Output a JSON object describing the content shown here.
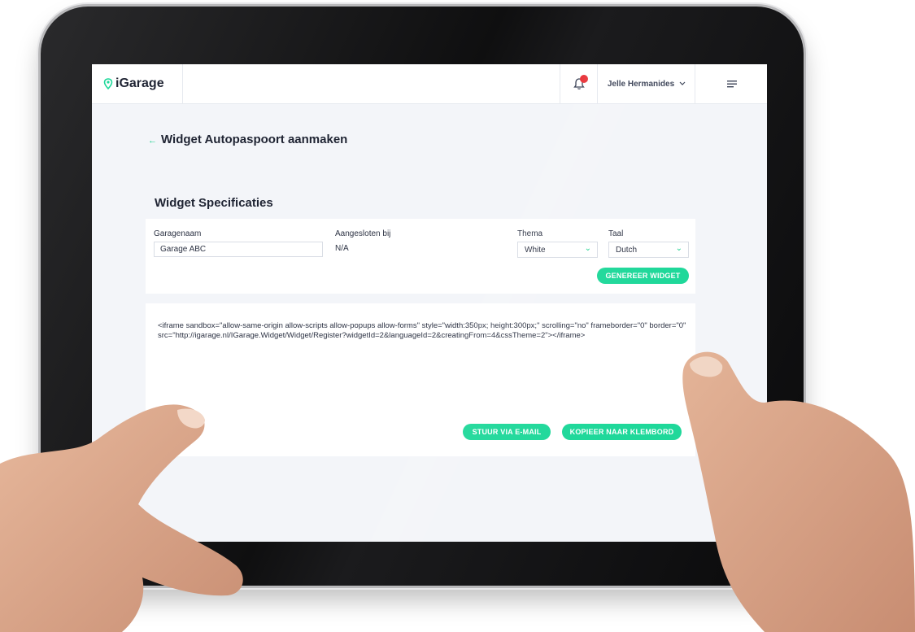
{
  "app": {
    "logo_text": "iGarage",
    "accent_color": "#1fd89a"
  },
  "header": {
    "user_name": "Jelle Hermanides",
    "notification_icon": "bell-icon",
    "menu_icon": "hamburger-icon"
  },
  "page": {
    "title": "Widget Autopaspoort aanmaken",
    "back_icon": "back-arrow-icon"
  },
  "specs": {
    "section_title": "Widget Specificaties",
    "garage_label": "Garagenaam",
    "garage_value": "Garage ABC",
    "connected_label": "Aangesloten bij",
    "connected_value": "N/A",
    "theme_label": "Thema",
    "theme_value": "White",
    "language_label": "Taal",
    "language_value": "Dutch",
    "generate_button": "GENEREER WIDGET"
  },
  "embed": {
    "code": "<iframe sandbox=\"allow-same-origin allow-scripts allow-popups allow-forms\" style=\"width:350px; height:300px;\" scrolling=\"no\" frameborder=\"0\" border=\"0\" src=\"http://igarage.nl/IGarage.Widget/Widget/Register?widgetId=2&languageId=2&creatingFrom=4&cssTheme=2\"></iframe>",
    "email_button": "STUUR VIA E-MAIL",
    "copy_button": "KOPIEER NAAR KLEMBORD"
  }
}
